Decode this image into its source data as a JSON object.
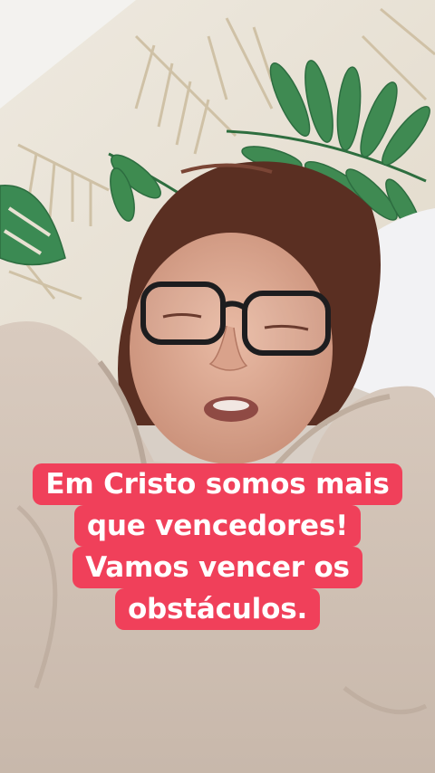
{
  "caption": {
    "lines": [
      "Em Cristo somos mais",
      "que vencedores!",
      "Vamos vencer os",
      "obstáculos."
    ],
    "background_color": "#f0405a",
    "text_color": "#ffffff"
  },
  "scene": {
    "description_icons": [
      "wallpaper-leaf-pattern",
      "person-face",
      "eyeglasses",
      "pillow",
      "fleece-blanket"
    ]
  }
}
